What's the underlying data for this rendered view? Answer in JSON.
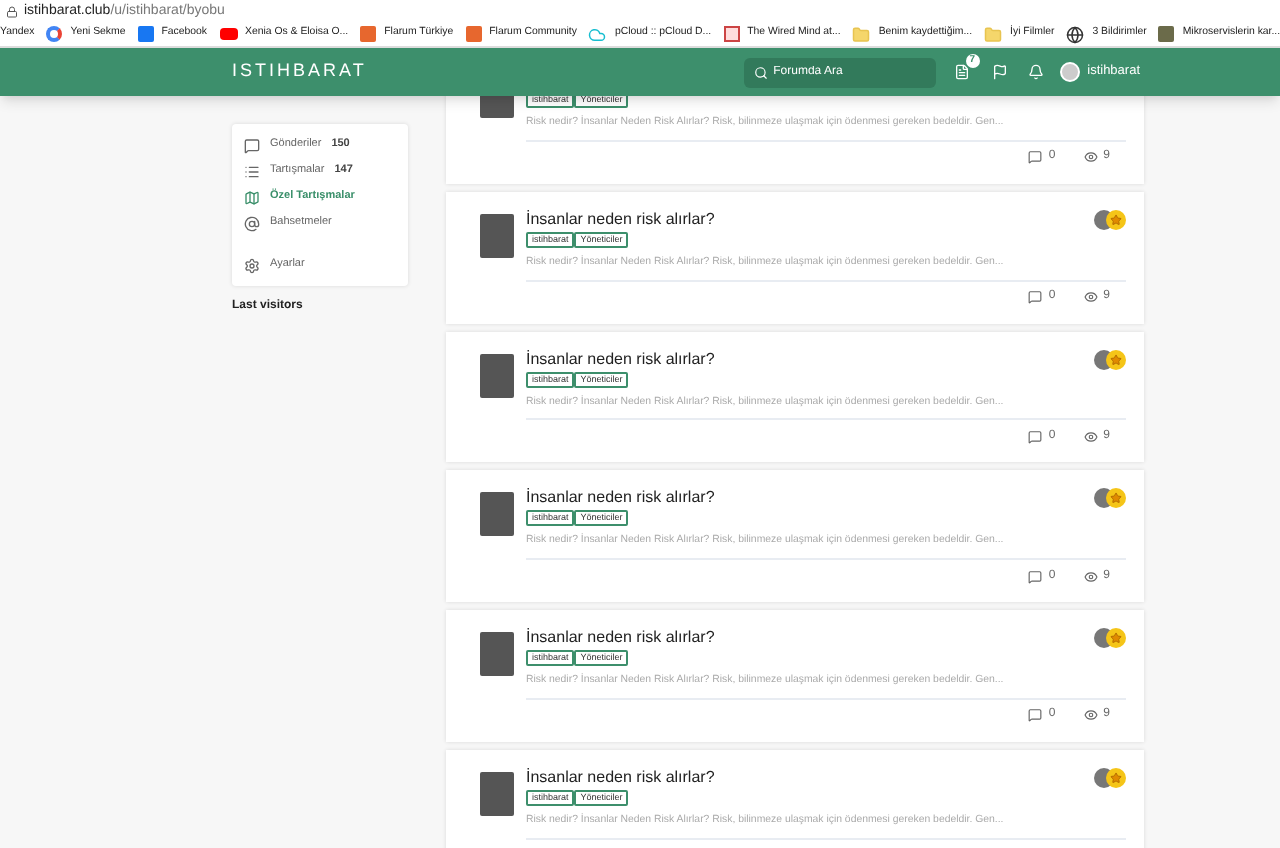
{
  "browser": {
    "url_domain": "istihbarat.club",
    "url_path": "/u/istihbarat/byobu",
    "bookmarks": [
      {
        "label": "Yandex",
        "kind": "none"
      },
      {
        "label": "Yeni Sekme",
        "kind": "google"
      },
      {
        "label": "Facebook",
        "kind": "facebook"
      },
      {
        "label": "Xenia Os & Eloisa O...",
        "kind": "youtube"
      },
      {
        "label": "Flarum Türkiye",
        "kind": "flarum"
      },
      {
        "label": "Flarum Community",
        "kind": "flarum"
      },
      {
        "label": "pCloud :: pCloud D...",
        "kind": "cloud"
      },
      {
        "label": "The Wired Mind at...",
        "kind": "grid"
      },
      {
        "label": "Benim kaydettiğim...",
        "kind": "folder"
      },
      {
        "label": "İyi Filmler",
        "kind": "folder"
      },
      {
        "label": "3 Bildirimler",
        "kind": "globe"
      },
      {
        "label": "Mikroservislerin kar...",
        "kind": "photo"
      }
    ]
  },
  "header": {
    "logo": "ISTIHBARAT",
    "search_placeholder": "Forumda Ara",
    "notification_count": "7",
    "username": "istihbarat"
  },
  "sidebar": {
    "items": [
      {
        "label": "Gönderiler",
        "count": "150",
        "kind": "comment",
        "selected": false
      },
      {
        "label": "Tartışmalar",
        "count": "147",
        "kind": "list",
        "selected": false
      },
      {
        "label": "Özel Tartışmalar",
        "kind": "map",
        "selected": true
      },
      {
        "label": "Bahsetmeler",
        "kind": "at",
        "selected": false
      },
      {
        "label": "Ayarlar",
        "kind": "gear",
        "selected": false
      }
    ],
    "last_visitors": "Last visitors"
  },
  "posts": [
    {
      "tags": [
        "istihbarat",
        "Yöneticiler"
      ],
      "excerpt": "Risk nedir? İnsanlar Neden Risk Alırlar? Risk, bilinmeze ulaşmak için ödenmesi gereken bedeldir. Gen...",
      "replies": "0",
      "views": "9"
    },
    {
      "title": "İnsanlar neden risk alırlar?",
      "tags": [
        "istihbarat",
        "Yöneticiler"
      ],
      "excerpt": "Risk nedir? İnsanlar Neden Risk Alırlar? Risk, bilinmeze ulaşmak için ödenmesi gereken bedeldir. Gen...",
      "replies": "0",
      "views": "9"
    },
    {
      "title": "İnsanlar neden risk alırlar?",
      "tags": [
        "istihbarat",
        "Yöneticiler"
      ],
      "excerpt": "Risk nedir? İnsanlar Neden Risk Alırlar? Risk, bilinmeze ulaşmak için ödenmesi gereken bedeldir. Gen...",
      "replies": "0",
      "views": "9"
    },
    {
      "title": "İnsanlar neden risk alırlar?",
      "tags": [
        "istihbarat",
        "Yöneticiler"
      ],
      "excerpt": "Risk nedir? İnsanlar Neden Risk Alırlar? Risk, bilinmeze ulaşmak için ödenmesi gereken bedeldir. Gen...",
      "replies": "0",
      "views": "9"
    },
    {
      "title": "İnsanlar neden risk alırlar?",
      "tags": [
        "istihbarat",
        "Yöneticiler"
      ],
      "excerpt": "Risk nedir? İnsanlar Neden Risk Alırlar? Risk, bilinmeze ulaşmak için ödenmesi gereken bedeldir. Gen...",
      "replies": "0",
      "views": "9"
    },
    {
      "title": "İnsanlar neden risk alırlar?",
      "tags": [
        "istihbarat",
        "Yöneticiler"
      ],
      "excerpt": "Risk nedir? İnsanlar Neden Risk Alırlar? Risk, bilinmeze ulaşmak için ödenmesi gereken bedeldir. Gen..."
    }
  ]
}
